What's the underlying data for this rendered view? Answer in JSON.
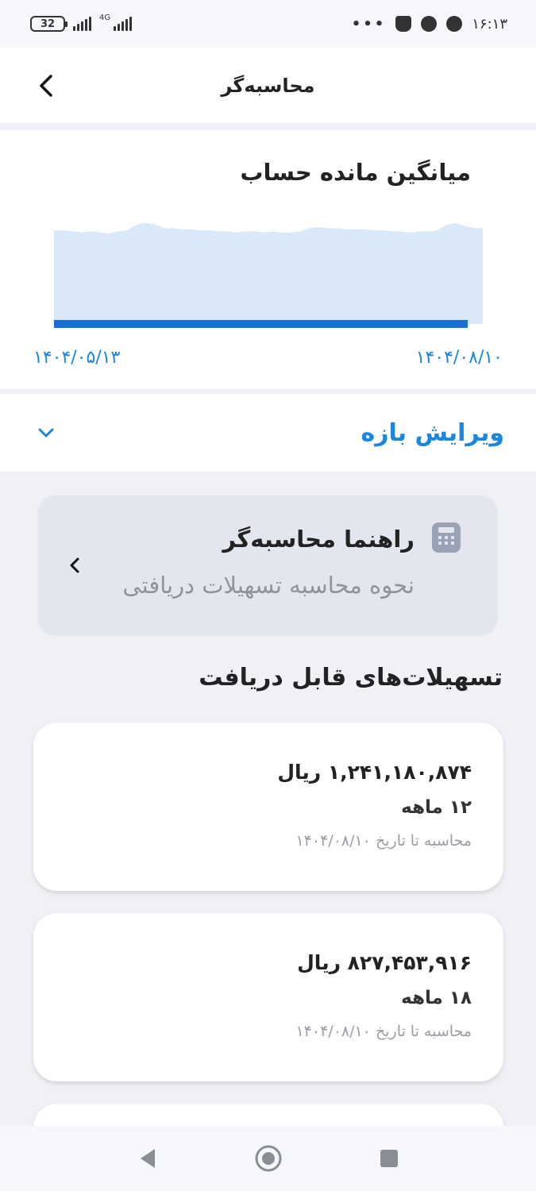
{
  "status_bar": {
    "battery": "32",
    "network": "4G",
    "time": "۱۶:۱۳",
    "overflow": "•••",
    "icons": [
      "shop-icon",
      "whatsapp-icon",
      "chat-icon"
    ]
  },
  "header": {
    "title": "محاسبه‌گر",
    "back_icon": "chevron-left-icon"
  },
  "chart": {
    "title": "میانگین مانده حساب",
    "start_date": "۱۴۰۴/۰۵/۱۳",
    "end_date": "۱۴۰۴/۰۸/۱۰",
    "colors": {
      "fill": "#d9e9fa",
      "bar": "#1a6fd6"
    }
  },
  "chart_data": {
    "type": "area",
    "title": "میانگین مانده حساب",
    "x": [
      "۱۴۰۴/۰۵/۱۳",
      "۱۴۰۴/۰۸/۱۰"
    ],
    "series": [
      {
        "values": [
          0.88,
          0.88,
          0.87,
          0.86,
          0.87,
          0.86,
          0.85,
          0.87,
          0.88,
          0.93,
          0.95,
          0.94,
          0.9,
          0.9,
          0.89,
          0.89,
          0.88,
          0.88,
          0.87,
          0.87,
          0.86,
          0.87,
          0.87,
          0.86,
          0.87,
          0.86,
          0.86,
          0.87,
          0.9,
          0.91,
          0.9,
          0.9,
          0.89,
          0.89,
          0.89,
          0.88,
          0.88,
          0.87,
          0.87,
          0.86,
          0.87,
          0.87,
          0.88,
          0.93,
          0.95,
          0.92,
          0.9,
          0.9
        ]
      }
    ],
    "grid": false
  },
  "range": {
    "label": "ویرایش بازه",
    "icon": "chevron-down-icon"
  },
  "guide": {
    "title": "راهنما محاسبه‌گر",
    "subtitle": "نحوه محاسبه تسهیلات دریافتی",
    "icon": "calculator-icon"
  },
  "section": {
    "title": "تسهیلات‌های قابل دریافت"
  },
  "loans": [
    {
      "amount": "۱,۲۴۱,۱۸۰,۸۷۴ ریال",
      "term": "۱۲ ماهه",
      "date_label": "محاسبه تا تاریخ ۱۴۰۴/۰۸/۱۰"
    },
    {
      "amount": "۸۲۷,۴۵۳,۹۱۶ ریال",
      "term": "۱۸ ماهه",
      "date_label": "محاسبه تا تاریخ ۱۴۰۴/۰۸/۱۰"
    }
  ],
  "nav": {
    "back_icon": "back-triangle-icon",
    "home_icon": "home-circle-icon",
    "recents_icon": "recents-square-icon"
  }
}
